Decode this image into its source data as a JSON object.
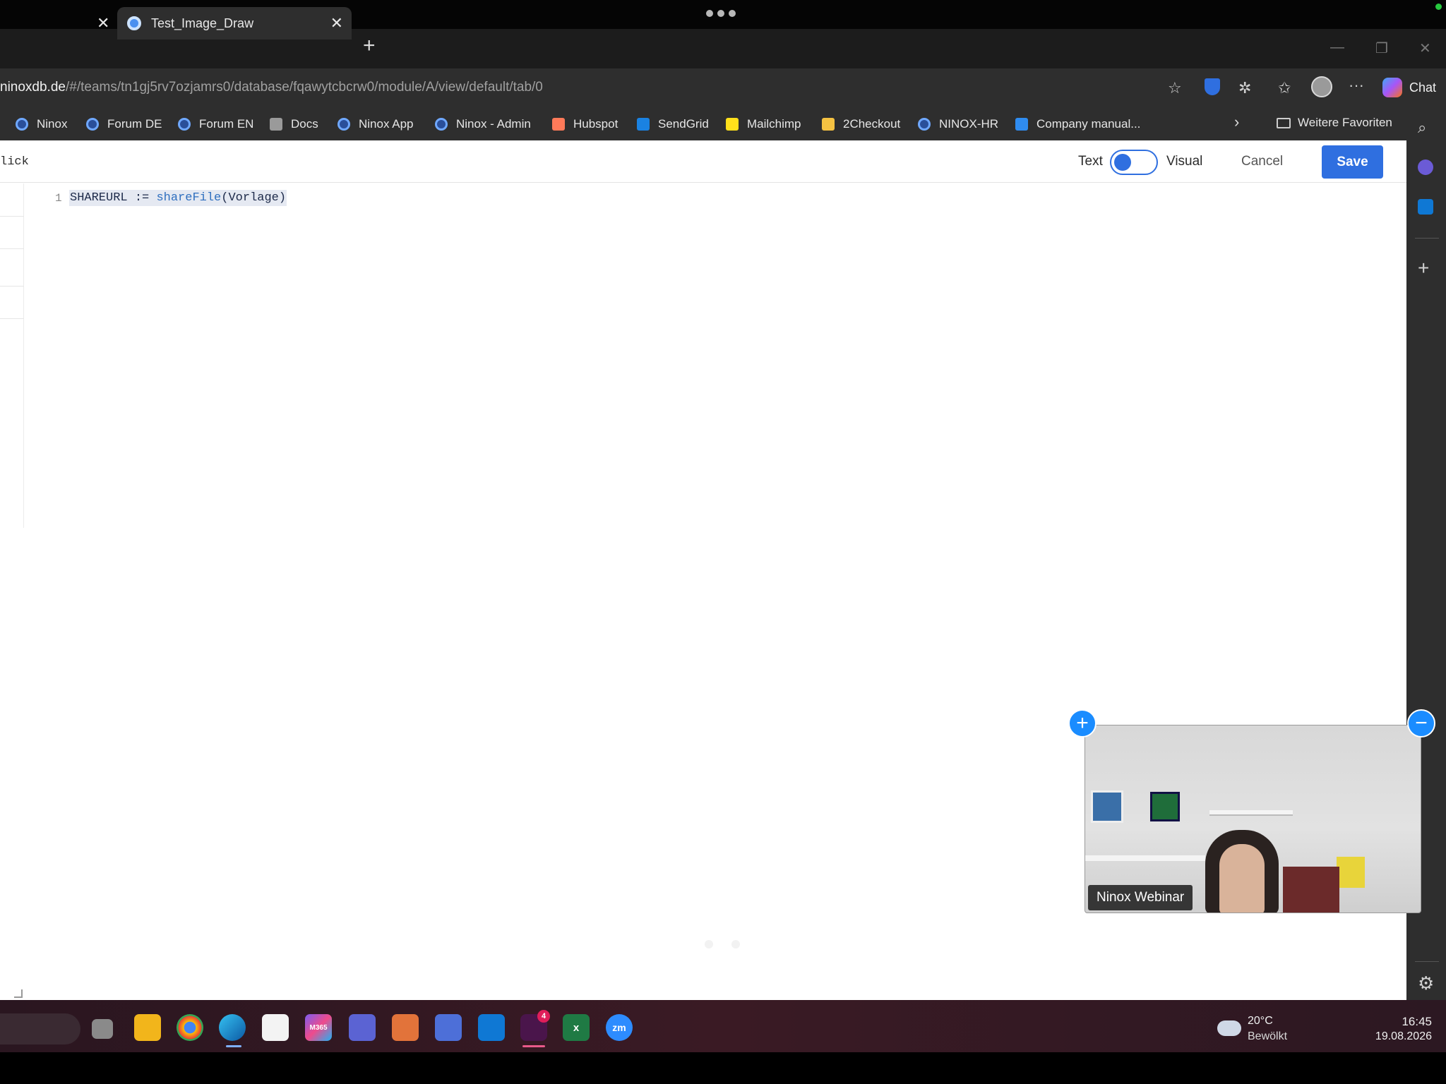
{
  "browser": {
    "tabs": [
      {
        "label": ""
      },
      {
        "label": "Test_Image_Draw"
      }
    ],
    "url_host": "ninoxdb.de",
    "url_path": "/#/teams/tn1gj5rv7ozjamrs0/database/fqawytcbcrw0/module/A/view/default/tab/0",
    "chat_label": "Chat",
    "bookmarks": [
      {
        "label": "Ninox"
      },
      {
        "label": "Forum DE"
      },
      {
        "label": "Forum EN"
      },
      {
        "label": "Docs"
      },
      {
        "label": "Ninox App"
      },
      {
        "label": "Ninox - Admin"
      },
      {
        "label": "Hubspot"
      },
      {
        "label": "SendGrid"
      },
      {
        "label": "Mailchimp"
      },
      {
        "label": "2Checkout"
      },
      {
        "label": "NINOX-HR"
      },
      {
        "label": "Company manual..."
      }
    ],
    "more_favorites": "Weitere Favoriten"
  },
  "editor": {
    "title_fragment": "lick",
    "toggle_text_label": "Text",
    "toggle_visual_label": "Visual",
    "cancel_label": "Cancel",
    "save_label": "Save",
    "line_number": "1",
    "code": {
      "var": "SHAREURL",
      "op": " := ",
      "fn": "shareFile",
      "args": "(Vorlage)"
    }
  },
  "video": {
    "label": "Ninox Webinar"
  },
  "taskbar": {
    "apps": [
      "file-explorer-icon",
      "chrome-icon",
      "edge-icon",
      "store-icon",
      "m365-icon",
      "teams-icon",
      "slides-icon",
      "calendar-icon",
      "outlook-icon",
      "slack-icon",
      "excel-icon",
      "zoom-icon"
    ],
    "slack_badge": "4",
    "m365_label": "M365",
    "zoom_label": "zm",
    "excel_label": "x",
    "weather_temp": "20°C",
    "weather_cond": "Bewölkt",
    "time": "16:45",
    "date": "19.08.2026"
  },
  "colors": {
    "accent": "#2f6fe0",
    "zoom_blue": "#1a8cff"
  }
}
